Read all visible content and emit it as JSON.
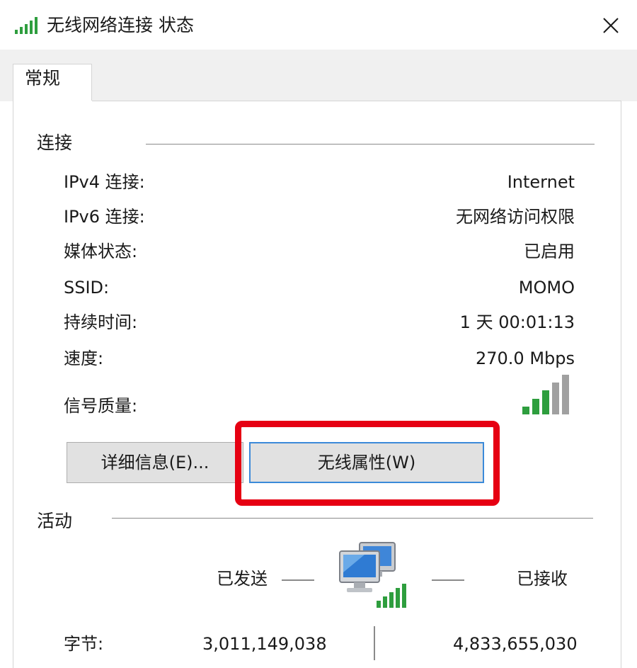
{
  "window": {
    "title": "无线网络连接 状态"
  },
  "tabs": [
    {
      "label": "常规",
      "active": true
    }
  ],
  "connection": {
    "section_title": "连接",
    "rows": [
      {
        "label": "IPv4 连接:",
        "value": "Internet"
      },
      {
        "label": "IPv6 连接:",
        "value": "无网络访问权限"
      },
      {
        "label": "媒体状态:",
        "value": "已启用"
      },
      {
        "label": "SSID:",
        "value": "MOMO"
      },
      {
        "label": "持续时间:",
        "value": "1 天 00:01:13"
      },
      {
        "label": "速度:",
        "value": "270.0 Mbps"
      }
    ],
    "signal_label": "信号质量:",
    "signal_bars_lit": 3,
    "signal_bars_total": 5
  },
  "buttons": {
    "details": "详细信息(E)...",
    "wireless_properties": "无线属性(W)"
  },
  "activity": {
    "section_title": "活动",
    "sent_label": "已发送",
    "received_label": "已接收",
    "bytes_label": "字节:",
    "bytes_sent": "3,011,149,038",
    "bytes_received": "4,833,655,030"
  },
  "colors": {
    "highlight": "#e60012",
    "signal_green": "#2e9e3e",
    "signal_gray": "#a0a0a0",
    "focus_blue": "#3b8ad9"
  },
  "icons": {
    "title": "wifi-signal-icon",
    "close": "close-icon",
    "signal": "signal-strength-icon",
    "network": "network-computers-icon"
  }
}
